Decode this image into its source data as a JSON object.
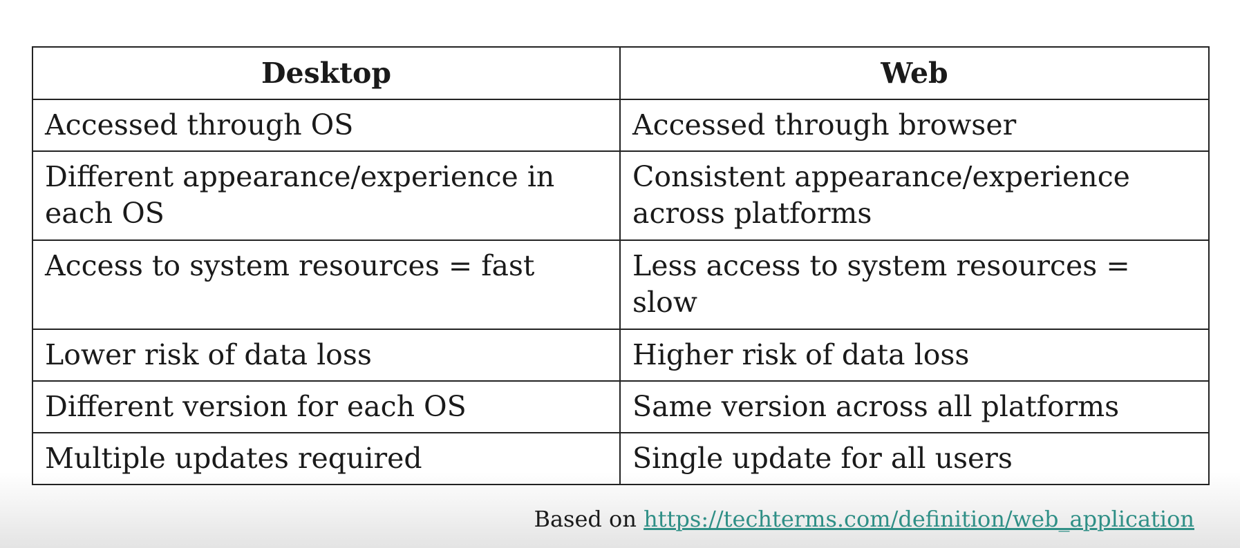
{
  "table": {
    "headers": [
      "Desktop",
      "Web"
    ],
    "rows": [
      [
        "Accessed through OS",
        "Accessed through browser"
      ],
      [
        "Different appearance/experience in each OS",
        "Consistent appearance/experience across platforms"
      ],
      [
        "Access to system resources = fast",
        "Less access to system resources = slow"
      ],
      [
        "Lower risk of data loss",
        "Higher risk of data loss"
      ],
      [
        "Different version for each OS",
        "Same version across all platforms"
      ],
      [
        "Multiple updates required",
        "Single update for all users"
      ]
    ]
  },
  "source": {
    "prefix": "Based on",
    "link_text": "https://techterms.com/definition/web_application"
  },
  "colors": {
    "link": "#2f8f86",
    "border": "#222222",
    "text": "#1a1a1a"
  }
}
